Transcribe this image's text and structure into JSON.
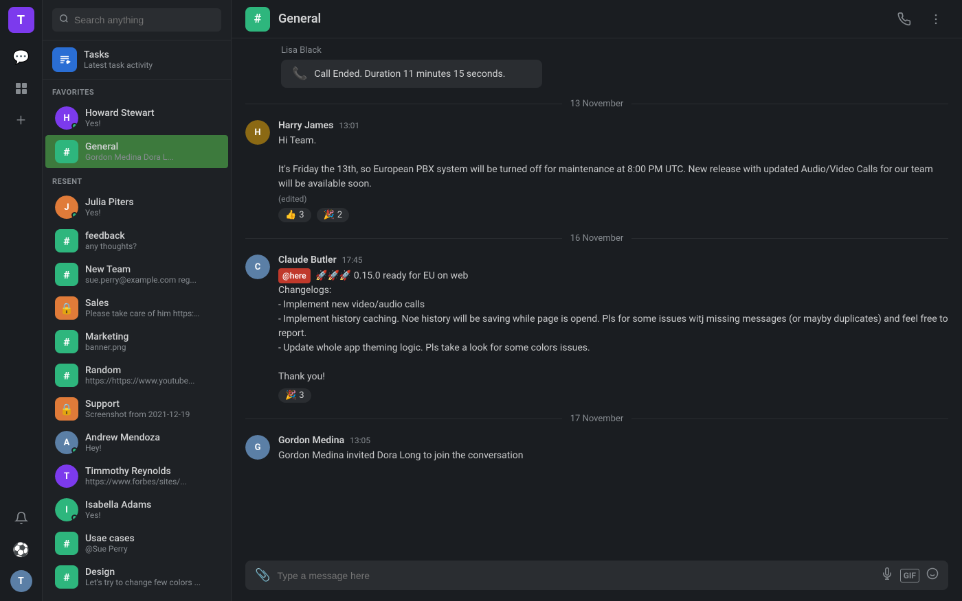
{
  "iconBar": {
    "userInitial": "T",
    "icons": [
      {
        "name": "chat-icon",
        "symbol": "💬"
      },
      {
        "name": "grid-icon",
        "symbol": "⊞"
      },
      {
        "name": "plus-icon",
        "symbol": "+"
      }
    ],
    "bottomIcons": [
      {
        "name": "bell-icon",
        "symbol": "🔔"
      },
      {
        "name": "soccer-icon",
        "symbol": "⚽"
      },
      {
        "name": "user-bottom-icon",
        "symbol": "👤"
      }
    ]
  },
  "sidebar": {
    "searchPlaceholder": "Search anything",
    "tasks": {
      "title": "Tasks",
      "subtitle": "Latest task activity"
    },
    "favorites": {
      "label": "FAVORITES",
      "items": [
        {
          "id": "howard",
          "type": "dm",
          "name": "Howard Stewart",
          "sub": "Yes!",
          "online": true,
          "color": "#7c3aed",
          "initial": "H"
        },
        {
          "id": "general",
          "type": "channel",
          "name": "General",
          "sub": "Gordon Medina Dora L...",
          "active": true,
          "color": "#2eb67d"
        }
      ]
    },
    "recent": {
      "label": "RESENT",
      "items": [
        {
          "id": "julia",
          "type": "dm",
          "name": "Julia Piters",
          "sub": "Yes!",
          "online": true,
          "color": "#e07b39",
          "initial": "J"
        },
        {
          "id": "feedback",
          "type": "channel",
          "name": "feedback",
          "sub": "any thoughts?",
          "color": "#2eb67d"
        },
        {
          "id": "newteam",
          "type": "channel",
          "name": "New Team",
          "sub": "sue.perry@example.com reg...",
          "color": "#2eb67d"
        },
        {
          "id": "sales",
          "type": "channel",
          "name": "Sales",
          "sub": "Please take care of him https:/...",
          "color": "#e07b39",
          "locked": true
        },
        {
          "id": "marketing",
          "type": "channel",
          "name": "Marketing",
          "sub": "banner.png",
          "color": "#2eb67d"
        },
        {
          "id": "random",
          "type": "channel",
          "name": "Random",
          "sub": "https://https://www.youtube...",
          "color": "#2eb67d"
        },
        {
          "id": "support",
          "type": "channel",
          "name": "Support",
          "sub": "Screenshot from 2021-12-19",
          "color": "#e07b39",
          "locked": true
        },
        {
          "id": "andrew",
          "type": "dm",
          "name": "Andrew Mendoza",
          "sub": "Hey!",
          "online": true,
          "color": "#5b7fa6",
          "initial": "A"
        },
        {
          "id": "timmothy",
          "type": "dm",
          "name": "Timmothy Reynolds",
          "sub": "https://www.forbes/sites/...",
          "online": false,
          "color": "#7c3aed",
          "initial": "T"
        },
        {
          "id": "isabella",
          "type": "dm",
          "name": "Isabella Adams",
          "sub": "Yes!",
          "online": true,
          "color": "#2eb67d",
          "initial": "I"
        },
        {
          "id": "usecases",
          "type": "channel",
          "name": "Usae cases",
          "sub": "@Sue Perry",
          "color": "#2eb67d"
        },
        {
          "id": "design",
          "type": "channel",
          "name": "Design",
          "sub": "Let's try to change few colors ...",
          "color": "#2eb67d"
        }
      ]
    }
  },
  "header": {
    "channelIcon": "#",
    "channelName": "General",
    "phoneIcon": "📞",
    "moreIcon": "⋮"
  },
  "chat": {
    "callEnded": {
      "senderName": "Lisa Black",
      "text": "Call Ended. Duration 11 minutes 15 seconds."
    },
    "dateSeparators": {
      "nov13": "13 November",
      "nov16": "16  November",
      "nov17": "17  November"
    },
    "messages": [
      {
        "id": "harry-msg",
        "sender": "Harry James",
        "time": "13:01",
        "avatarColor": "#8b4513",
        "initial": "H",
        "lines": [
          "Hi Team.",
          "",
          "It's Friday the 13th, so European PBX system will be turned off for maintenance at 8:00 PM UTC. New release with updated Audio/Video Calls for our team will be available soon."
        ],
        "edited": true,
        "reactions": [
          {
            "emoji": "👍",
            "count": "3"
          },
          {
            "emoji": "🎉",
            "count": "2"
          }
        ]
      },
      {
        "id": "claude-msg",
        "sender": "Claude Butler",
        "time": "17:45",
        "avatarColor": "#5b7fa6",
        "initial": "C",
        "atHere": true,
        "lines": [
          "🚀🚀🚀 0.15.0 ready for EU on web",
          "Changelogs:",
          "- Implement new video/audio calls",
          "- Implement history caching. Noe history will be saving while page is opend. Pls for some issues witj missing messages (or mayby duplicates) and  feel free to report.",
          "- Update whole app theming logic. Pls take a look for some colors issues.",
          "",
          "Thank you!"
        ],
        "reactions": [
          {
            "emoji": "🎉",
            "count": "3"
          }
        ]
      },
      {
        "id": "gordon-msg",
        "sender": "Gordon Medina",
        "time": "13:05",
        "avatarColor": "#5b7fa6",
        "initial": "G",
        "lines": [
          "Gordon Medina invited Dora Long to join the conversation"
        ]
      }
    ]
  },
  "messageInput": {
    "placeholder": "Type a message here",
    "attachIcon": "📎",
    "micIcon": "🎤",
    "gifIcon": "GIF",
    "emojiIcon": "🙂"
  }
}
